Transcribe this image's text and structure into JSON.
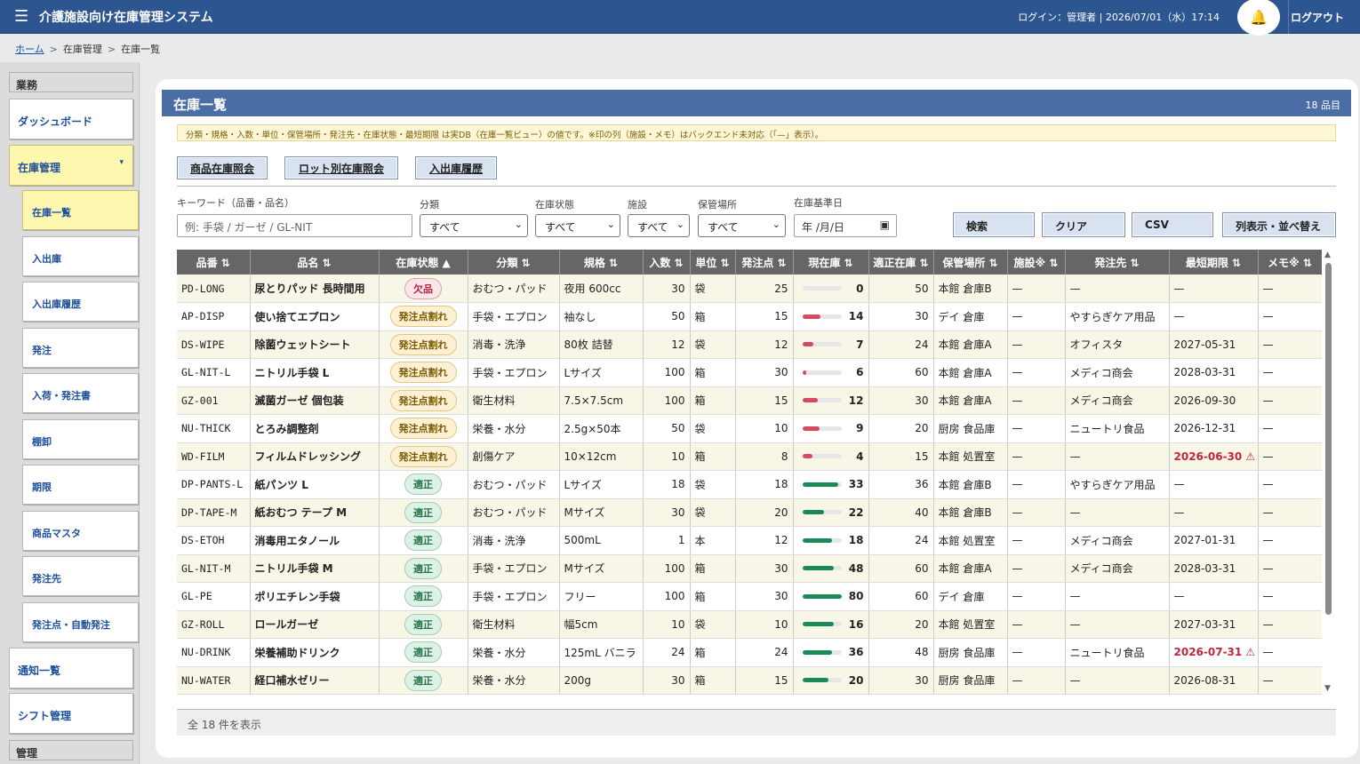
{
  "header": {
    "title": "介護施設向け在庫管理システム",
    "login": "ログイン：管理者 | 2026/07/01（水）17:14",
    "logout": "ログアウト"
  },
  "breadcrumb": {
    "home": "ホーム",
    "mid": "在庫管理",
    "current": "在庫一覧"
  },
  "sidebar": {
    "sec_ops": "業務",
    "sec_admin": "管理",
    "dashboard": "ダッシュボード",
    "inventory": "在庫管理",
    "sub": [
      "在庫一覧",
      "入出庫",
      "入出庫履歴",
      "発注",
      "入荷・発注書",
      "棚卸",
      "期限",
      "商品マスタ",
      "発注先",
      "発注点・自動発注"
    ],
    "notifications": "通知一覧",
    "shift": "シフト管理"
  },
  "panel": {
    "title": "在庫一覧",
    "count": "18 品目",
    "note": "分類・規格・入数・単位・保管場所・発注先・在庫状態・最短期限 は実DB（在庫一覧ビュー）の値です。※印の列（施設・メモ）はバックエンド未対応（「—」表示）。",
    "tabs": [
      "商品在庫照会",
      "ロット別在庫照会",
      "入出庫履歴"
    ]
  },
  "filters": {
    "keyword_label": "キーワード（品番・品名）",
    "keyword_placeholder": "例: 手袋 / ガーゼ / GL-NIT",
    "category_label": "分類",
    "category_value": "すべて",
    "status_label": "在庫状態",
    "status_value": "すべて",
    "facility_label": "施設",
    "facility_value": "すべて",
    "location_label": "保管場所",
    "location_value": "すべて",
    "date_label": "在庫基準日",
    "date_value": "年 /月/日",
    "search": "検索",
    "clear": "クリア",
    "csv": "CSV",
    "columns": "列表示・並べ替え"
  },
  "table": {
    "headers": [
      "品番 ⇅",
      "品名 ⇅",
      "在庫状態 ▲",
      "分類 ⇅",
      "規格 ⇅",
      "入数 ⇅",
      "単位 ⇅",
      "発注点 ⇅",
      "現在庫 ⇅",
      "適正在庫 ⇅",
      "保管場所 ⇅",
      "施設※ ⇅",
      "発注先 ⇅",
      "最短期限 ⇅",
      "メモ※ ⇅"
    ],
    "rows": [
      {
        "code": "PD-LONG",
        "name": "尿とりパッド 長時間用",
        "status": "欠品",
        "cat": "おむつ・パッド",
        "spec": "夜用 600cc",
        "qty": "30",
        "unit": "袋",
        "reorder": "25",
        "stock": "0",
        "optimal": "50",
        "loc": "本館 倉庫B",
        "fac": "—",
        "supplier": "—",
        "exp": "—",
        "exp_warn": false,
        "memo": "—"
      },
      {
        "code": "AP-DISP",
        "name": "使い捨てエプロン",
        "status": "発注点割れ",
        "cat": "手袋・エプロン",
        "spec": "袖なし",
        "qty": "50",
        "unit": "箱",
        "reorder": "15",
        "stock": "14",
        "optimal": "30",
        "loc": "デイ 倉庫",
        "fac": "—",
        "supplier": "やすらぎケア用品",
        "exp": "—",
        "exp_warn": false,
        "memo": "—"
      },
      {
        "code": "DS-WIPE",
        "name": "除菌ウェットシート",
        "status": "発注点割れ",
        "cat": "消毒・洗浄",
        "spec": "80枚 詰替",
        "qty": "12",
        "unit": "袋",
        "reorder": "12",
        "stock": "7",
        "optimal": "24",
        "loc": "本館 倉庫A",
        "fac": "—",
        "supplier": "オフィスタ",
        "exp": "2027-05-31",
        "exp_warn": false,
        "memo": "—"
      },
      {
        "code": "GL-NIT-L",
        "name": "ニトリル手袋 L",
        "status": "発注点割れ",
        "cat": "手袋・エプロン",
        "spec": "Lサイズ",
        "qty": "100",
        "unit": "箱",
        "reorder": "30",
        "stock": "6",
        "optimal": "60",
        "loc": "本館 倉庫A",
        "fac": "—",
        "supplier": "メディコ商会",
        "exp": "2028-03-31",
        "exp_warn": false,
        "memo": "—"
      },
      {
        "code": "GZ-001",
        "name": "滅菌ガーゼ 個包装",
        "status": "発注点割れ",
        "cat": "衛生材料",
        "spec": "7.5×7.5cm",
        "qty": "100",
        "unit": "箱",
        "reorder": "15",
        "stock": "12",
        "optimal": "30",
        "loc": "本館 倉庫A",
        "fac": "—",
        "supplier": "メディコ商会",
        "exp": "2026-09-30",
        "exp_warn": false,
        "memo": "—"
      },
      {
        "code": "NU-THICK",
        "name": "とろみ調整剤",
        "status": "発注点割れ",
        "cat": "栄養・水分",
        "spec": "2.5g×50本",
        "qty": "50",
        "unit": "袋",
        "reorder": "10",
        "stock": "9",
        "optimal": "20",
        "loc": "厨房 食品庫",
        "fac": "—",
        "supplier": "ニュートリ食品",
        "exp": "2026-12-31",
        "exp_warn": false,
        "memo": "—"
      },
      {
        "code": "WD-FILM",
        "name": "フィルムドレッシング",
        "status": "発注点割れ",
        "cat": "創傷ケア",
        "spec": "10×12cm",
        "qty": "10",
        "unit": "箱",
        "reorder": "8",
        "stock": "4",
        "optimal": "15",
        "loc": "本館 処置室",
        "fac": "—",
        "supplier": "—",
        "exp": "2026-06-30 ⚠",
        "exp_warn": true,
        "memo": "—"
      },
      {
        "code": "DP-PANTS-L",
        "name": "紙パンツ L",
        "status": "適正",
        "cat": "おむつ・パッド",
        "spec": "Lサイズ",
        "qty": "18",
        "unit": "袋",
        "reorder": "18",
        "stock": "33",
        "optimal": "36",
        "loc": "本館 倉庫B",
        "fac": "—",
        "supplier": "やすらぎケア用品",
        "exp": "—",
        "exp_warn": false,
        "memo": "—"
      },
      {
        "code": "DP-TAPE-M",
        "name": "紙おむつ テープ M",
        "status": "適正",
        "cat": "おむつ・パッド",
        "spec": "Mサイズ",
        "qty": "30",
        "unit": "袋",
        "reorder": "20",
        "stock": "22",
        "optimal": "40",
        "loc": "本館 倉庫B",
        "fac": "—",
        "supplier": "—",
        "exp": "—",
        "exp_warn": false,
        "memo": "—"
      },
      {
        "code": "DS-ETOH",
        "name": "消毒用エタノール",
        "status": "適正",
        "cat": "消毒・洗浄",
        "spec": "500mL",
        "qty": "1",
        "unit": "本",
        "reorder": "12",
        "stock": "18",
        "optimal": "24",
        "loc": "本館 処置室",
        "fac": "—",
        "supplier": "メディコ商会",
        "exp": "2027-01-31",
        "exp_warn": false,
        "memo": "—"
      },
      {
        "code": "GL-NIT-M",
        "name": "ニトリル手袋 M",
        "status": "適正",
        "cat": "手袋・エプロン",
        "spec": "Mサイズ",
        "qty": "100",
        "unit": "箱",
        "reorder": "30",
        "stock": "48",
        "optimal": "60",
        "loc": "本館 倉庫A",
        "fac": "—",
        "supplier": "メディコ商会",
        "exp": "2028-03-31",
        "exp_warn": false,
        "memo": "—"
      },
      {
        "code": "GL-PE",
        "name": "ポリエチレン手袋",
        "status": "適正",
        "cat": "手袋・エプロン",
        "spec": "フリー",
        "qty": "100",
        "unit": "箱",
        "reorder": "30",
        "stock": "80",
        "optimal": "60",
        "loc": "デイ 倉庫",
        "fac": "—",
        "supplier": "—",
        "exp": "—",
        "exp_warn": false,
        "memo": "—"
      },
      {
        "code": "GZ-ROLL",
        "name": "ロールガーゼ",
        "status": "適正",
        "cat": "衛生材料",
        "spec": "幅5cm",
        "qty": "10",
        "unit": "袋",
        "reorder": "10",
        "stock": "16",
        "optimal": "20",
        "loc": "本館 処置室",
        "fac": "—",
        "supplier": "—",
        "exp": "2027-03-31",
        "exp_warn": false,
        "memo": "—"
      },
      {
        "code": "NU-DRINK",
        "name": "栄養補助ドリンク",
        "status": "適正",
        "cat": "栄養・水分",
        "spec": "125mL バニラ",
        "qty": "24",
        "unit": "箱",
        "reorder": "24",
        "stock": "36",
        "optimal": "48",
        "loc": "厨房 食品庫",
        "fac": "—",
        "supplier": "ニュートリ食品",
        "exp": "2026-07-31 ⚠",
        "exp_warn": true,
        "memo": "—"
      },
      {
        "code": "NU-WATER",
        "name": "経口補水ゼリー",
        "status": "適正",
        "cat": "栄養・水分",
        "spec": "200g",
        "qty": "30",
        "unit": "箱",
        "reorder": "15",
        "stock": "20",
        "optimal": "30",
        "loc": "厨房 食品庫",
        "fac": "—",
        "supplier": "—",
        "exp": "2026-08-31",
        "exp_warn": false,
        "memo": "—"
      }
    ]
  },
  "footer": "全 18 件を表示",
  "colors": {
    "header": "#2d5590",
    "panel_head": "#4a6da6",
    "active_nav": "#fdf7b0",
    "bar_low": "#d44a62",
    "bar_ok": "#1c8a57"
  }
}
